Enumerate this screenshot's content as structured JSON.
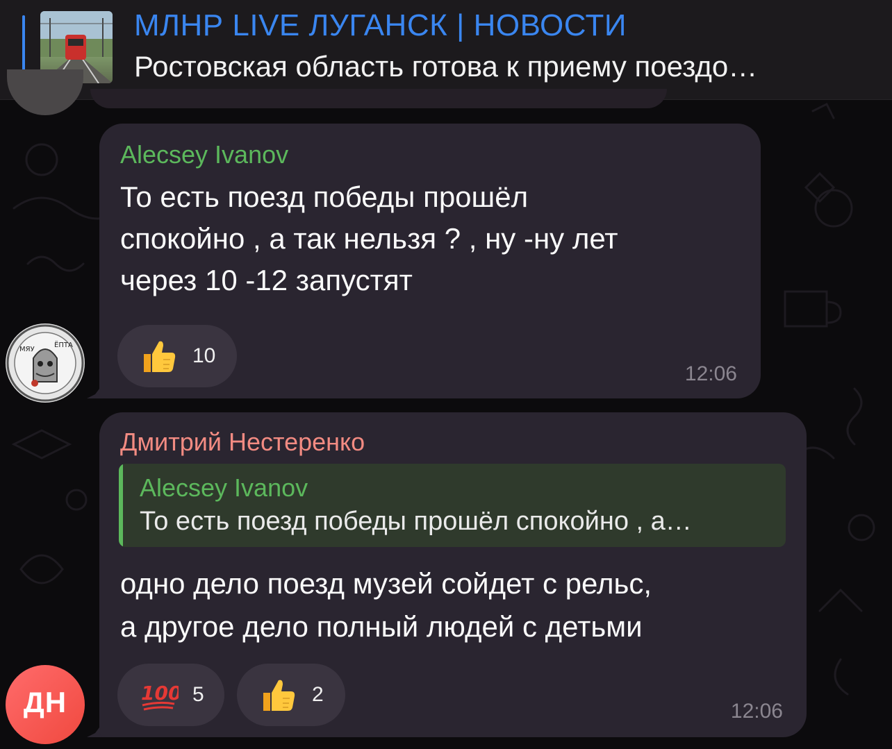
{
  "pinned": {
    "channel_title": "МЛНР LIVE ЛУГАНСК | НОВОСТИ",
    "preview_text": "Ростовская область готова к приему поездо…",
    "thumbnail": "train-photo"
  },
  "messages": [
    {
      "author": "Alecsey Ivanov",
      "author_color": "#5cb85c",
      "text": "То есть поезд победы прошёл\nспокойно , а так нельзя ? , ну -ну лет\nчерез 10 -12 запустят",
      "reactions": [
        {
          "emoji": "thumbs-up",
          "count": "10"
        }
      ],
      "time": "12:06",
      "avatar": {
        "type": "sticker-cat"
      }
    },
    {
      "author": "Дмитрий Нестеренко",
      "author_color": "#f28b82",
      "reply": {
        "author": "Alecsey Ivanov",
        "text": "То есть поезд победы прошёл спокойно , а…"
      },
      "text": "одно дело поезд музей сойдет с рельс,\nа другое дело полный людей с детьми",
      "reactions": [
        {
          "emoji": "hundred-points",
          "count": "5"
        },
        {
          "emoji": "thumbs-up",
          "count": "2"
        }
      ],
      "time": "12:06",
      "avatar": {
        "initials": "ДН",
        "color": "#f0493f"
      }
    }
  ],
  "colors": {
    "accent": "#3a86f0",
    "bubble": "#2a2530",
    "background": "#0c0b0d"
  }
}
